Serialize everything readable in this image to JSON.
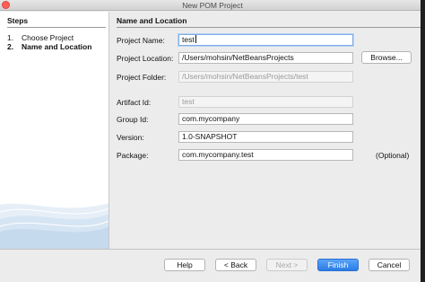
{
  "window": {
    "title": "New POM Project"
  },
  "steps": {
    "title": "Steps",
    "items": [
      {
        "num": "1.",
        "label": "Choose Project"
      },
      {
        "num": "2.",
        "label": "Name and Location"
      }
    ]
  },
  "section": {
    "title": "Name and Location"
  },
  "form": {
    "project_name": {
      "label": "Project Name:",
      "value": "test"
    },
    "project_location": {
      "label": "Project Location:",
      "value": "/Users/mohsin/NetBeansProjects"
    },
    "browse_label": "Browse...",
    "project_folder": {
      "label": "Project Folder:",
      "value": "/Users/mohsin/NetBeansProjects/test"
    },
    "artifact_id": {
      "label": "Artifact Id:",
      "value": "test"
    },
    "group_id": {
      "label": "Group Id:",
      "value": "com.mycompany"
    },
    "version": {
      "label": "Version:",
      "value": "1.0-SNAPSHOT"
    },
    "package": {
      "label": "Package:",
      "value": "com.mycompany.test",
      "note": "(Optional)"
    }
  },
  "buttons": {
    "help": "Help",
    "back": "< Back",
    "next": "Next >",
    "finish": "Finish",
    "cancel": "Cancel"
  },
  "colors": {
    "primary_button": "#2a7de6",
    "focus_ring": "#7eabe6",
    "close_button": "#ff5f57"
  }
}
